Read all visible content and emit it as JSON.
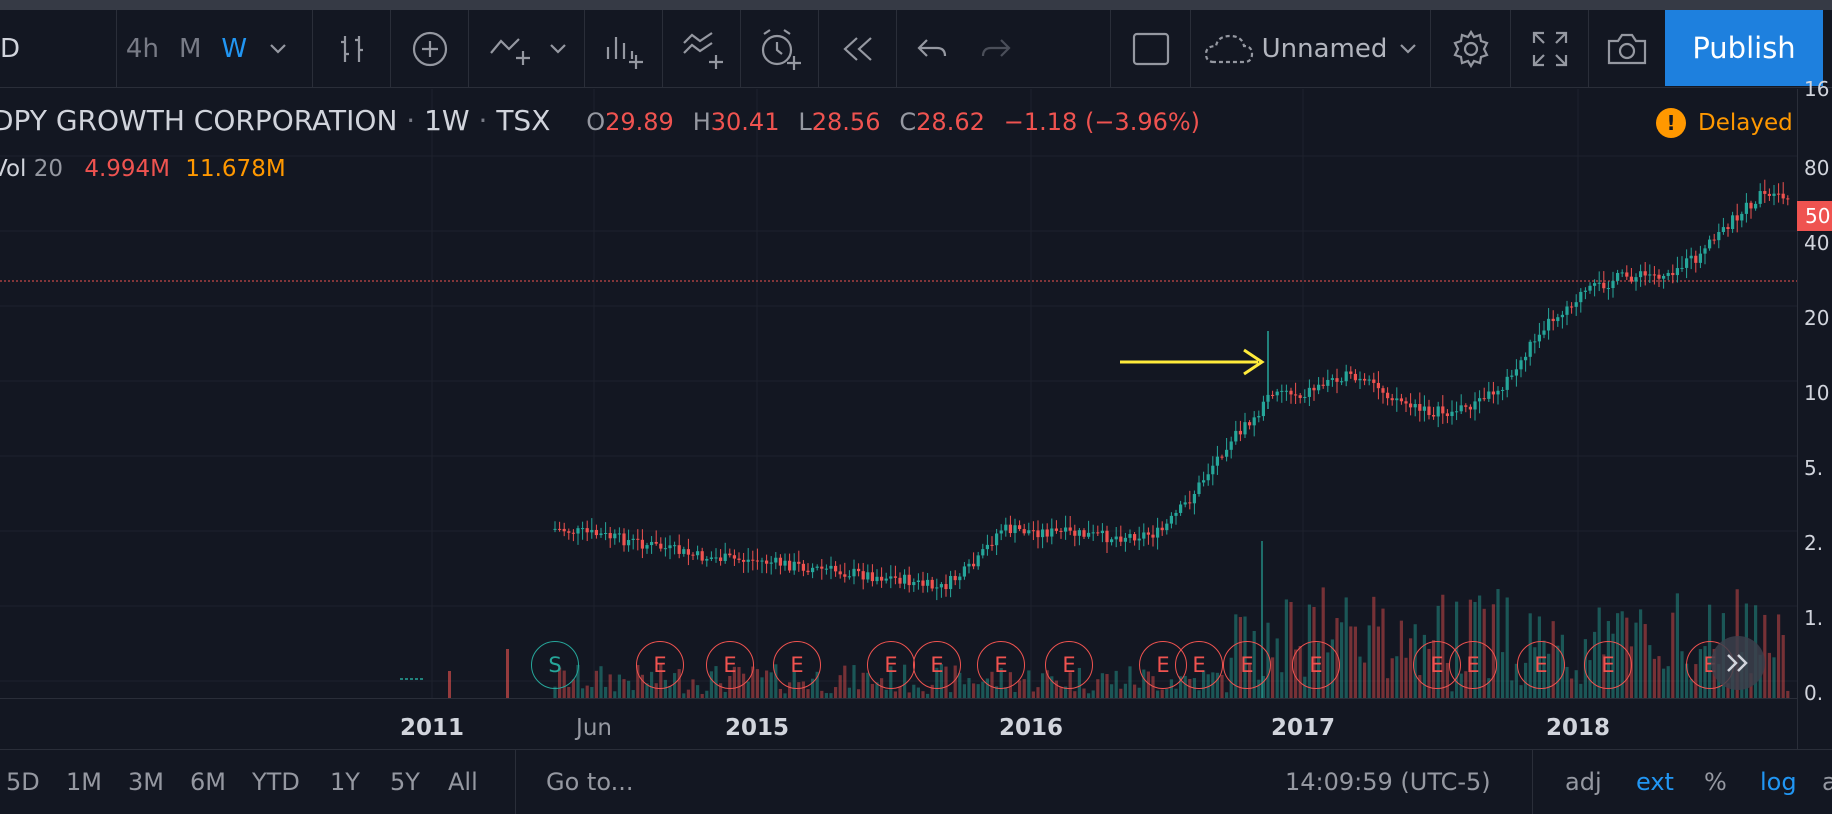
{
  "toolbar": {
    "symbol_fragment": "D",
    "interval_4h": "4h",
    "interval_m": "M",
    "interval_w": "W",
    "layout_name": "Unnamed",
    "publish_label": "Publish"
  },
  "legend": {
    "title": "DPY GROWTH CORPORATION",
    "interval": "1W",
    "exchange": "TSX",
    "o_key": "O",
    "o_val": "29.89",
    "h_key": "H",
    "h_val": "30.41",
    "l_key": "L",
    "l_val": "28.56",
    "c_key": "C",
    "c_val": "28.62",
    "change": "−1.18 (−3.96%)",
    "vol_key": "Vol",
    "vol_len": "20",
    "vol_val": "4.994M",
    "vol_ma": "11.678M",
    "delayed_label": "Delayed"
  },
  "price_axis": {
    "labels": [
      "16",
      "80",
      "40",
      "20",
      "10",
      "5.",
      "2.",
      "1.",
      "0."
    ],
    "last_price_flag": "50"
  },
  "time_axis": {
    "labels": [
      "2011",
      "Jun",
      "2015",
      "2016",
      "2017",
      "2018"
    ]
  },
  "markers": [
    "S",
    "E",
    "E",
    "E",
    "E",
    "E",
    "E",
    "E",
    "E",
    "E",
    "E",
    "E",
    "E",
    "E",
    "E",
    "E",
    "E"
  ],
  "bottombar": {
    "ranges": [
      "5D",
      "1M",
      "3M",
      "6M",
      "YTD",
      "1Y",
      "5Y",
      "All"
    ],
    "goto": "Go to...",
    "clock": "14:09:59 (UTC-5)",
    "adj": "adj",
    "ext": "ext",
    "pct": "%",
    "log": "log",
    "auto_fragment": "a"
  },
  "colors": {
    "background": "#131722",
    "up": "#26a69a",
    "down": "#ef5350",
    "accent": "#2196f3",
    "annotation_arrow": "#ffeb3b",
    "delayed": "#ff9800"
  }
}
